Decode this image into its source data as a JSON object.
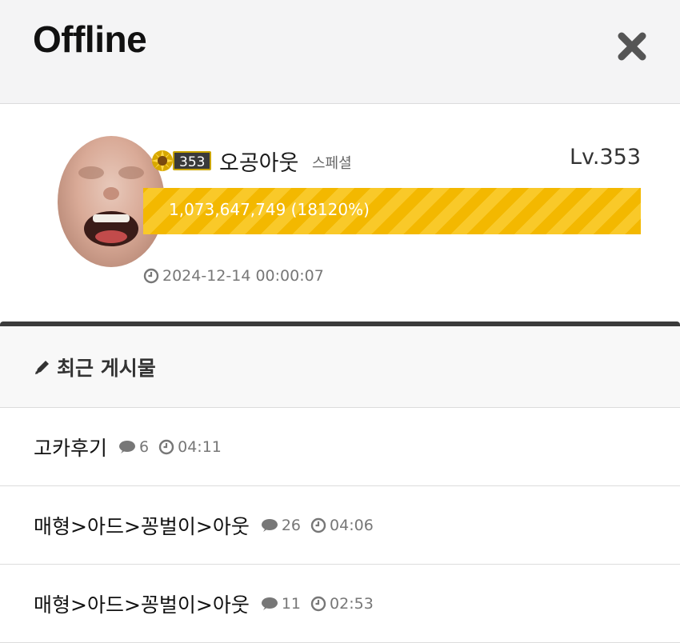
{
  "header": {
    "title": "Offline"
  },
  "profile": {
    "level_badge": "353",
    "nickname": "오공아웃",
    "rank": "스페셜",
    "level": "Lv.353",
    "exp_text": "1,073,647,749 (18120%)",
    "date": "2024-12-14 00:00:07"
  },
  "recent": {
    "header": "최근 게시물",
    "posts": [
      {
        "title": "고카후기",
        "comments": "6",
        "time": "04:11"
      },
      {
        "title": "매형>아드>꽁벌이>아웃",
        "comments": "26",
        "time": "04:06"
      },
      {
        "title": "매형>아드>꽁벌이>아웃",
        "comments": "11",
        "time": "02:53"
      }
    ]
  },
  "colors": {
    "exp_bar": "#f3b800",
    "dark_divider": "#3b3b3b",
    "header_bg": "#f4f4f5"
  }
}
